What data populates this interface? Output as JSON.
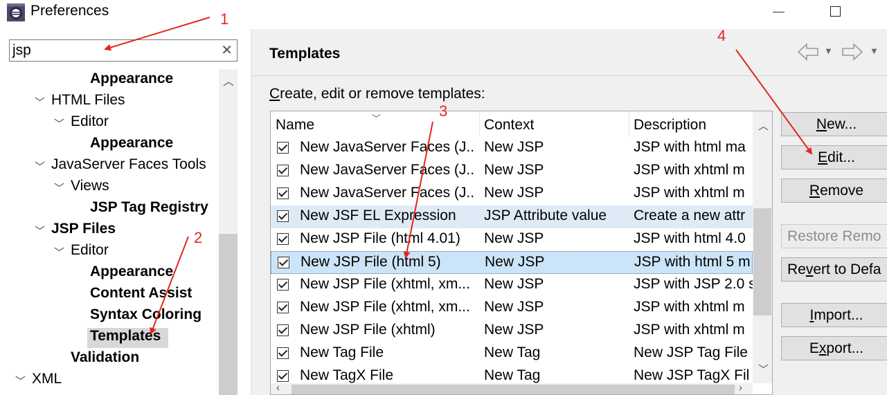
{
  "window": {
    "title": "Preferences"
  },
  "filter": {
    "value": "jsp"
  },
  "tree": [
    {
      "label": "Appearance",
      "bold": true
    },
    {
      "label": "HTML Files",
      "bold": false
    },
    {
      "label": "Editor",
      "bold": false
    },
    {
      "label": "Appearance",
      "bold": true
    },
    {
      "label": "JavaServer Faces Tools",
      "bold": false
    },
    {
      "label": "Views",
      "bold": false
    },
    {
      "label": "JSP Tag Registry",
      "bold": true
    },
    {
      "label": "JSP Files",
      "bold": true
    },
    {
      "label": "Editor",
      "bold": false
    },
    {
      "label": "Appearance",
      "bold": true
    },
    {
      "label": "Content Assist",
      "bold": true
    },
    {
      "label": "Syntax Coloring",
      "bold": true
    },
    {
      "label": "Templates",
      "bold": true,
      "selected": true
    },
    {
      "label": "Validation",
      "bold": true
    },
    {
      "label": "XML",
      "bold": false
    }
  ],
  "page": {
    "title": "Templates",
    "description": "Create, edit or remove templates:"
  },
  "table": {
    "columns": [
      "Name",
      "Context",
      "Description"
    ],
    "rows": [
      {
        "name": "New JavaServer Faces (J...",
        "context": "New JSP",
        "description": "JSP with html ma",
        "checked": true
      },
      {
        "name": "New JavaServer Faces (J...",
        "context": "New JSP",
        "description": "JSP with xhtml m",
        "checked": true
      },
      {
        "name": "New JavaServer Faces (J...",
        "context": "New JSP",
        "description": "JSP with xhtml m",
        "checked": true
      },
      {
        "name": "New JSF EL Expression",
        "context": "JSP Attribute value",
        "description": "Create a new attr",
        "checked": true
      },
      {
        "name": "New JSP File (html 4.01)",
        "context": "New JSP",
        "description": "JSP with html 4.0",
        "checked": true
      },
      {
        "name": "New JSP File (html 5)",
        "context": "New JSP",
        "description": "JSP with html 5 m",
        "checked": true,
        "selected": true
      },
      {
        "name": "New JSP File (xhtml, xm...",
        "context": "New JSP",
        "description": "JSP with JSP 2.0 s",
        "checked": true
      },
      {
        "name": "New JSP File (xhtml, xm...",
        "context": "New JSP",
        "description": "JSP with xhtml m",
        "checked": true
      },
      {
        "name": "New JSP File (xhtml)",
        "context": "New JSP",
        "description": "JSP with xhtml m",
        "checked": true
      },
      {
        "name": "New Tag File",
        "context": "New Tag",
        "description": "New JSP Tag File",
        "checked": true
      },
      {
        "name": "New TagX File",
        "context": "New Tag",
        "description": "New JSP TagX Fil",
        "checked": true
      }
    ]
  },
  "buttons": {
    "new": {
      "pre": "",
      "mn": "N",
      "post": "ew..."
    },
    "edit": {
      "pre": "",
      "mn": "E",
      "post": "dit..."
    },
    "remove": {
      "pre": "",
      "mn": "R",
      "post": "emove"
    },
    "restore": {
      "label": "Restore Remo"
    },
    "revert": {
      "pre": "Re",
      "mn": "v",
      "post": "ert to Defa"
    },
    "import": {
      "pre": "",
      "mn": "I",
      "post": "mport..."
    },
    "export": {
      "pre": "E",
      "mn": "x",
      "post": "port..."
    }
  },
  "annotations": [
    "1",
    "2",
    "3",
    "4"
  ],
  "colors": {
    "annotation": "#e0281e",
    "selection": "#cce4f7",
    "alt_row": "#dfeaf7"
  }
}
